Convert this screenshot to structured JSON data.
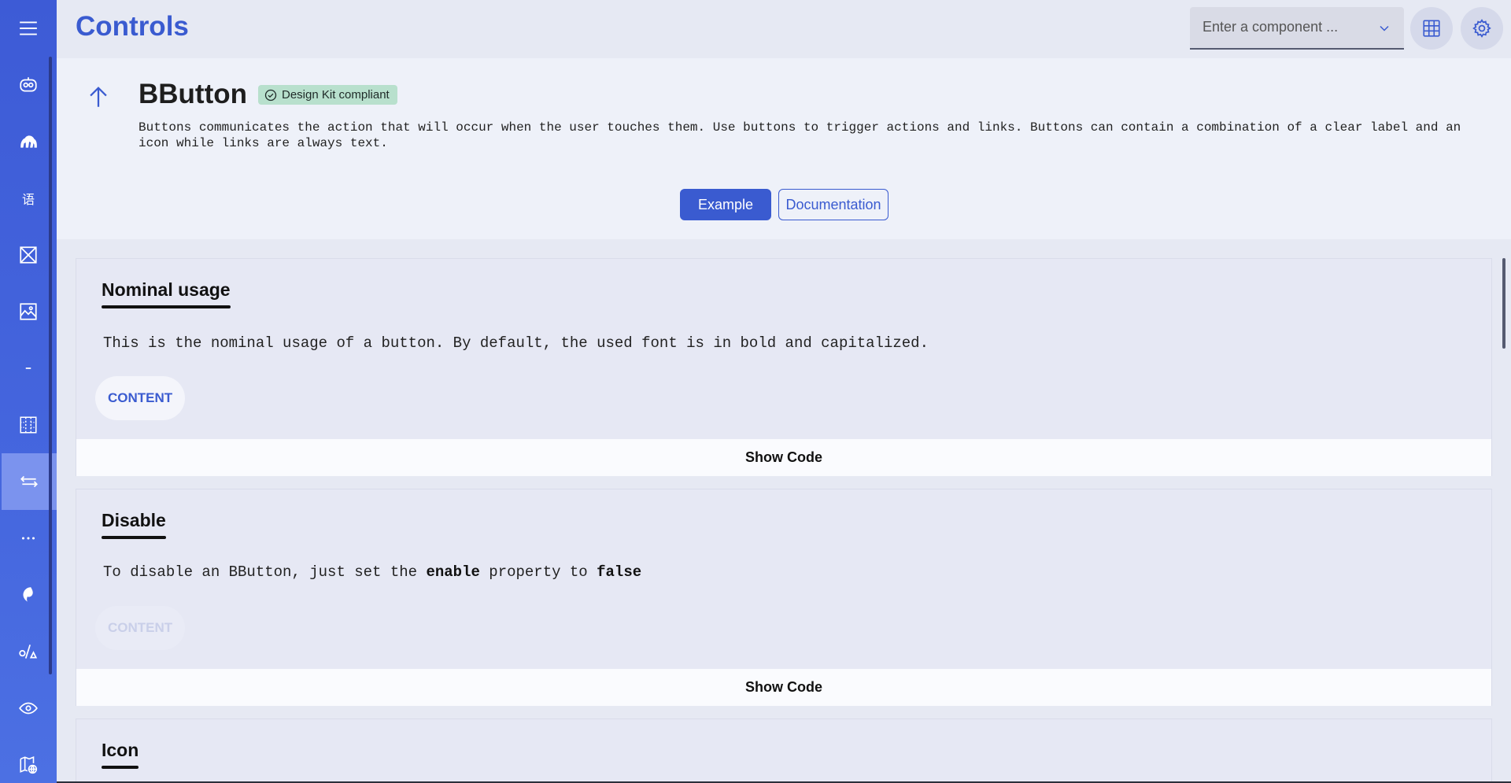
{
  "header": {
    "title": "Controls",
    "search_placeholder": "Enter a component ..."
  },
  "component": {
    "name": "BButton",
    "badge": "Design Kit compliant",
    "description": "Buttons communicates the action that will occur when the user touches them. Use buttons to trigger actions and links. Buttons can contain a combination of a clear label and an icon while links are always text.",
    "tabs": [
      "Example",
      "Documentation"
    ],
    "active_tab": "Example"
  },
  "sidebar": {
    "items": [
      {
        "icon": "menu-icon"
      },
      {
        "icon": "robot-icon"
      },
      {
        "icon": "hand-icon"
      },
      {
        "icon": "language-icon",
        "text": "语"
      },
      {
        "icon": "image-placeholder-icon"
      },
      {
        "icon": "image-icon"
      },
      {
        "icon": "minus-icon"
      },
      {
        "icon": "grid-icon"
      },
      {
        "icon": "swap-arrows-icon",
        "active": true
      },
      {
        "icon": "more-horizontal-icon"
      },
      {
        "icon": "spinner-icon"
      },
      {
        "icon": "shapes-icon"
      },
      {
        "icon": "eye-icon"
      },
      {
        "icon": "map-globe-icon"
      }
    ]
  },
  "sections": [
    {
      "title": "Nominal usage",
      "text": "This is the nominal usage of a button. By default, the used font is in bold and capitalized.",
      "button_label": "CONTENT",
      "show_code": "Show Code"
    },
    {
      "title": "Disable",
      "text_prefix": "To disable an BButton, just set the ",
      "text_bold1": "enable",
      "text_mid": " property to ",
      "text_bold2": "false",
      "button_label": "CONTENT",
      "show_code": "Show Code"
    },
    {
      "title": "Icon"
    }
  ],
  "colors": {
    "primary": "#3a5bd0",
    "sidebar": "#4566de",
    "badge_bg": "#b8e0cd"
  }
}
